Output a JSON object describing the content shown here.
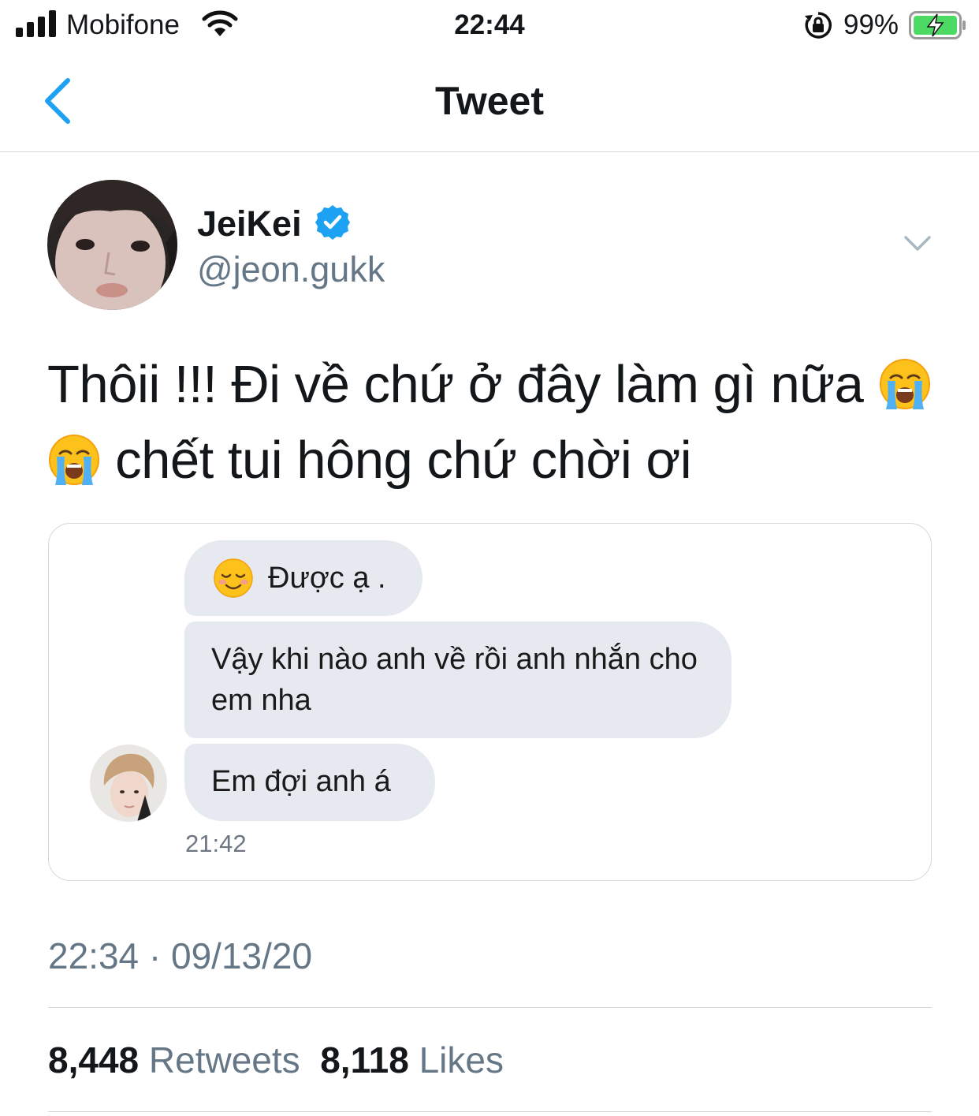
{
  "status_bar": {
    "carrier": "Mobifone",
    "time": "22:44",
    "battery_percent": "99%",
    "icons": [
      "signal-icon",
      "wifi-icon",
      "orientation-lock-icon",
      "battery-charging-icon"
    ]
  },
  "nav": {
    "title": "Tweet",
    "back_icon": "chevron-left-icon",
    "accent_color": "#1da1f2"
  },
  "author": {
    "name": "JeiKei",
    "handle": "@jeon.gukk",
    "verified": true
  },
  "tweet": {
    "line1": "Thôii !!! Đi về chứ ở đây làm gì nữa",
    "line2": "chết tui hông chứ chời ơi",
    "emoji": "loudly-crying-face"
  },
  "attached_image": {
    "messages": [
      {
        "emoji": "relieved-smiling-face",
        "text": "Được ạ ."
      },
      {
        "text": "Vậy khi nào anh về rồi anh nhắn cho em nha"
      },
      {
        "text": "Em đợi anh á"
      }
    ],
    "time": "21:42"
  },
  "meta": {
    "timestamp": "22:34 · 09/13/20",
    "retweets_count": "8,448",
    "retweets_label": "Retweets",
    "likes_count": "8,118",
    "likes_label": "Likes"
  }
}
